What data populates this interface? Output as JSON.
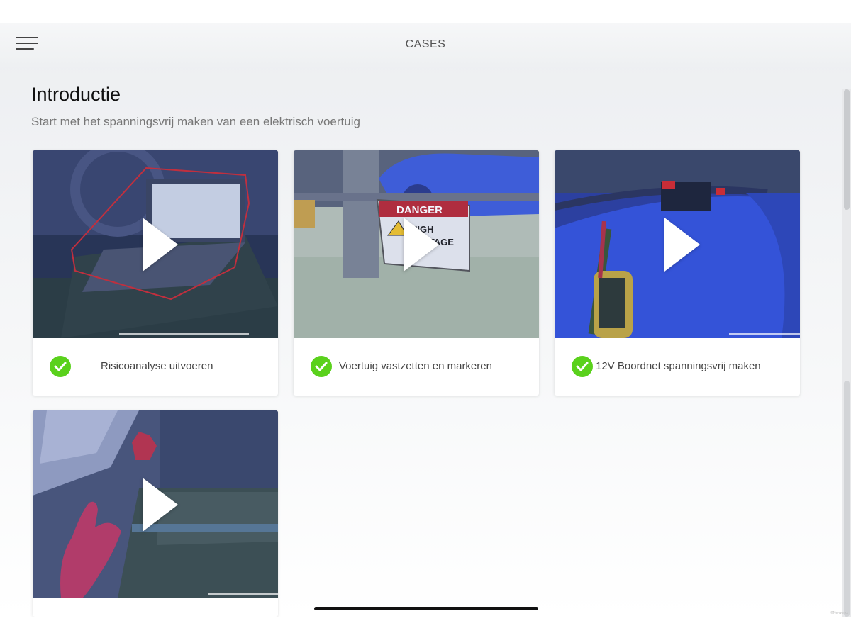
{
  "header": {
    "title": "CASES",
    "menu_icon": "hamburger-menu-icon"
  },
  "section": {
    "title": "Introductie",
    "subtitle": "Start met het spanningsvrij maken van een elektrisch voertuig"
  },
  "cards": [
    {
      "label": "Risicoanalyse uitvoeren",
      "completed": true,
      "progress": 0.53,
      "thumbnail": "laptop-in-car-scene"
    },
    {
      "label": "Voertuig vastzetten en markeren",
      "completed": true,
      "progress": 0,
      "thumbnail": "danger-high-voltage-sign-scene"
    },
    {
      "label": "12V Boordnet spanningsvrij maken",
      "completed": true,
      "progress": 0.29,
      "thumbnail": "voltage-tester-scene"
    },
    {
      "label": "",
      "completed": false,
      "progress": 0.28,
      "thumbnail": "gloved-hand-scene"
    }
  ],
  "thumb_text": {
    "danger_heading": "DANGER",
    "danger_line1": "HIGH",
    "danger_line2": "VOLTAGE"
  },
  "colors": {
    "check_green": "#5ad11c",
    "overlay_blue": "#3b57d6",
    "accent_red": "#d42a2a"
  },
  "footer": {
    "copyright": "©Ne-workx"
  }
}
